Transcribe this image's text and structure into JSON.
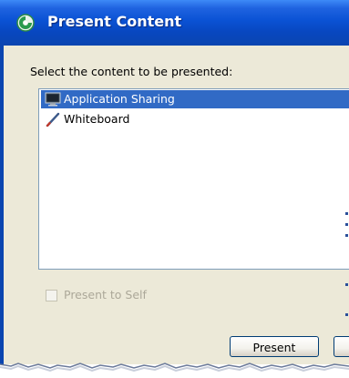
{
  "window": {
    "title": "Present Content"
  },
  "dialog": {
    "prompt": "Select the content to be presented:",
    "content_list": [
      {
        "label": "Application Sharing",
        "icon": "monitor-icon",
        "selected": true
      },
      {
        "label": "Whiteboard",
        "icon": "pen-icon",
        "selected": false
      }
    ],
    "present_to_self": {
      "label": "Present to Self",
      "checked": false,
      "enabled": false
    },
    "buttons": {
      "present_label": "Present",
      "second_label": ""
    }
  },
  "colors": {
    "titlebar": "#0a52d4",
    "selection": "#316ac5",
    "client_bg": "#ece9d8",
    "disabled_text": "#aca899"
  }
}
